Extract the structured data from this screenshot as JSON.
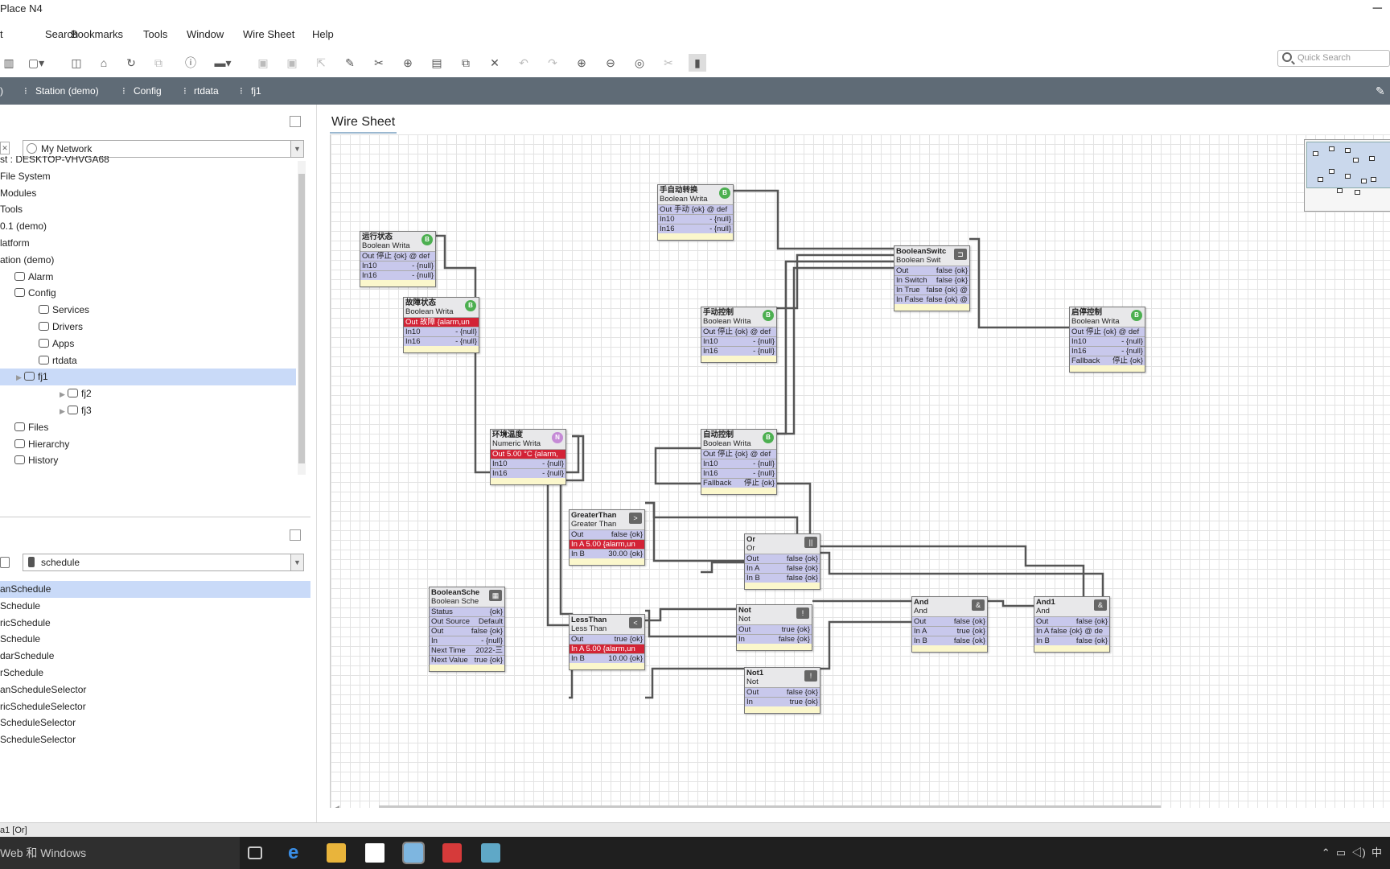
{
  "window": {
    "title": "Place N4",
    "minimize": "─"
  },
  "menu": [
    "t",
    "Search",
    "Bookmarks",
    "Tools",
    "Window",
    "Wire Sheet",
    "Help"
  ],
  "quick_search": {
    "placeholder": "Quick Search"
  },
  "breadcrumb": [
    ")",
    "Station (demo)",
    "Config",
    "rtdata",
    "fj1"
  ],
  "nav_panel": {
    "network": "My Network",
    "items": [
      {
        "label": "st : DESKTOP-VHVGA68",
        "indent": 0
      },
      {
        "label": "File System",
        "indent": 0
      },
      {
        "label": "Modules",
        "indent": 0
      },
      {
        "label": "Tools",
        "indent": 0
      },
      {
        "label": "0.1 (demo)",
        "indent": 0
      },
      {
        "label": "latform",
        "indent": 0
      },
      {
        "label": "ation (demo)",
        "indent": 0
      },
      {
        "label": "Alarm",
        "indent": 1
      },
      {
        "label": "Config",
        "indent": 1
      },
      {
        "label": "Services",
        "indent": 2
      },
      {
        "label": "Drivers",
        "indent": 2
      },
      {
        "label": "Apps",
        "indent": 2
      },
      {
        "label": "rtdata",
        "indent": 2
      },
      {
        "label": "fj1",
        "indent": 3,
        "selected": true
      },
      {
        "label": "fj2",
        "indent": 3
      },
      {
        "label": "fj3",
        "indent": 3
      },
      {
        "label": "Files",
        "indent": 1
      },
      {
        "label": "Hierarchy",
        "indent": 1
      },
      {
        "label": "History",
        "indent": 1
      }
    ]
  },
  "palette": {
    "module": "schedule",
    "items": [
      "anSchedule",
      "Schedule",
      "ricSchedule",
      "Schedule",
      "darSchedule",
      "rSchedule",
      "anScheduleSelector",
      "ricScheduleSelector",
      "ScheduleSelector",
      "ScheduleSelector"
    ]
  },
  "wiresheet": {
    "tab": "Wire Sheet",
    "nodes": [
      {
        "id": "n1",
        "title": "运行状态",
        "type": "Boolean Writa",
        "badge": "B",
        "badge_color": "#4caf50",
        "rows": [
          [
            "Out 停止 {ok} @ def",
            ""
          ],
          [
            "In10",
            "- {null}"
          ],
          [
            "In16",
            "- {null}"
          ]
        ]
      },
      {
        "id": "n2",
        "title": "故障状态",
        "type": "Boolean Writa",
        "badge": "B",
        "badge_color": "#4caf50",
        "rows": [
          [
            "Out 故障 {alarm,un",
            ""
          ],
          [
            "In10",
            "- {null}"
          ],
          [
            "In16",
            "- {null}"
          ]
        ],
        "alarm": [
          0
        ]
      },
      {
        "id": "n3",
        "title": "手自动转换",
        "type": "Boolean Writa",
        "badge": "B",
        "badge_color": "#4caf50",
        "rows": [
          [
            "Out 手动 {ok} @ def",
            ""
          ],
          [
            "In10",
            "- {null}"
          ],
          [
            "In16",
            "- {null}"
          ]
        ]
      },
      {
        "id": "n4",
        "title": "手动控制",
        "type": "Boolean Writa",
        "badge": "B",
        "badge_color": "#4caf50",
        "rows": [
          [
            "Out 停止 {ok} @ def",
            ""
          ],
          [
            "In10",
            "- {null}"
          ],
          [
            "In16",
            "- {null}"
          ]
        ]
      },
      {
        "id": "n5",
        "title": "BooleanSwitc",
        "type": "Boolean Swit",
        "sq": "⊐",
        "rows": [
          [
            "Out",
            "false {ok}"
          ],
          [
            "In Switch",
            "false {ok}"
          ],
          [
            "In True",
            "false {ok} @"
          ],
          [
            "In False",
            "false {ok} @"
          ]
        ]
      },
      {
        "id": "n6",
        "title": "启停控制",
        "type": "Boolean Writa",
        "badge": "B",
        "badge_color": "#4caf50",
        "rows": [
          [
            "Out 停止 {ok} @ def",
            ""
          ],
          [
            "In10",
            "- {null}"
          ],
          [
            "In16",
            "- {null}"
          ],
          [
            "Fallback",
            "停止 {ok}"
          ]
        ]
      },
      {
        "id": "n7",
        "title": "环境温度",
        "type": "Numeric Writa",
        "badge": "N",
        "badge_color": "#c58ad6",
        "rows": [
          [
            "Out 5.00 °C {alarm,",
            ""
          ],
          [
            "In10",
            "- {null}"
          ],
          [
            "In16",
            "- {null}"
          ]
        ],
        "alarm": [
          0
        ]
      },
      {
        "id": "n8",
        "title": "自动控制",
        "type": "Boolean Writa",
        "badge": "B",
        "badge_color": "#4caf50",
        "rows": [
          [
            "Out 停止 {ok} @ def",
            ""
          ],
          [
            "In10",
            "- {null}"
          ],
          [
            "In16",
            "- {null}"
          ],
          [
            "Fallback",
            "停止 {ok}"
          ]
        ]
      },
      {
        "id": "n9",
        "title": "GreaterThan",
        "type": "Greater Than",
        "sq": ">",
        "rows": [
          [
            "Out",
            "false {ok}"
          ],
          [
            "In A 5.00 {alarm,un",
            ""
          ],
          [
            "In B",
            "30.00 {ok}"
          ]
        ],
        "alarm": [
          1
        ]
      },
      {
        "id": "n10",
        "title": "Or",
        "type": "Or",
        "sq": "||",
        "rows": [
          [
            "Out",
            "false {ok}"
          ],
          [
            "In A",
            "false {ok}"
          ],
          [
            "In B",
            "false {ok}"
          ]
        ]
      },
      {
        "id": "n11",
        "title": "BooleanSche",
        "type": "Boolean Sche",
        "sq": "▦",
        "rows": [
          [
            "Status",
            "{ok}"
          ],
          [
            "Out Source",
            "Default"
          ],
          [
            "Out",
            "false {ok}"
          ],
          [
            "In",
            "- {null}"
          ],
          [
            "Next Time",
            "2022-三"
          ],
          [
            "Next Value",
            "true {ok}"
          ]
        ]
      },
      {
        "id": "n12",
        "title": "LessThan",
        "type": "Less Than",
        "sq": "<",
        "rows": [
          [
            "Out",
            "true {ok}"
          ],
          [
            "In A 5.00 {alarm,un",
            ""
          ],
          [
            "In B",
            "10.00 {ok}"
          ]
        ],
        "alarm": [
          1
        ]
      },
      {
        "id": "n13",
        "title": "Not",
        "type": "Not",
        "sq": "!",
        "rows": [
          [
            "Out",
            "true {ok}"
          ],
          [
            "In",
            "false {ok}"
          ]
        ]
      },
      {
        "id": "n14",
        "title": "Not1",
        "type": "Not",
        "sq": "!",
        "rows": [
          [
            "Out",
            "false {ok}"
          ],
          [
            "In",
            "true {ok}"
          ]
        ]
      },
      {
        "id": "n15",
        "title": "And",
        "type": "And",
        "sq": "&",
        "rows": [
          [
            "Out",
            "false {ok}"
          ],
          [
            "In A",
            "true {ok}"
          ],
          [
            "In B",
            "false {ok}"
          ]
        ]
      },
      {
        "id": "n16",
        "title": "And1",
        "type": "And",
        "sq": "&",
        "rows": [
          [
            "Out",
            "false {ok}"
          ],
          [
            "In A false {ok} @ de",
            ""
          ],
          [
            "In B",
            "false {ok}"
          ]
        ]
      }
    ]
  },
  "status": "a1 [Or]",
  "taskbar": {
    "search": "Web 和 Windows"
  }
}
